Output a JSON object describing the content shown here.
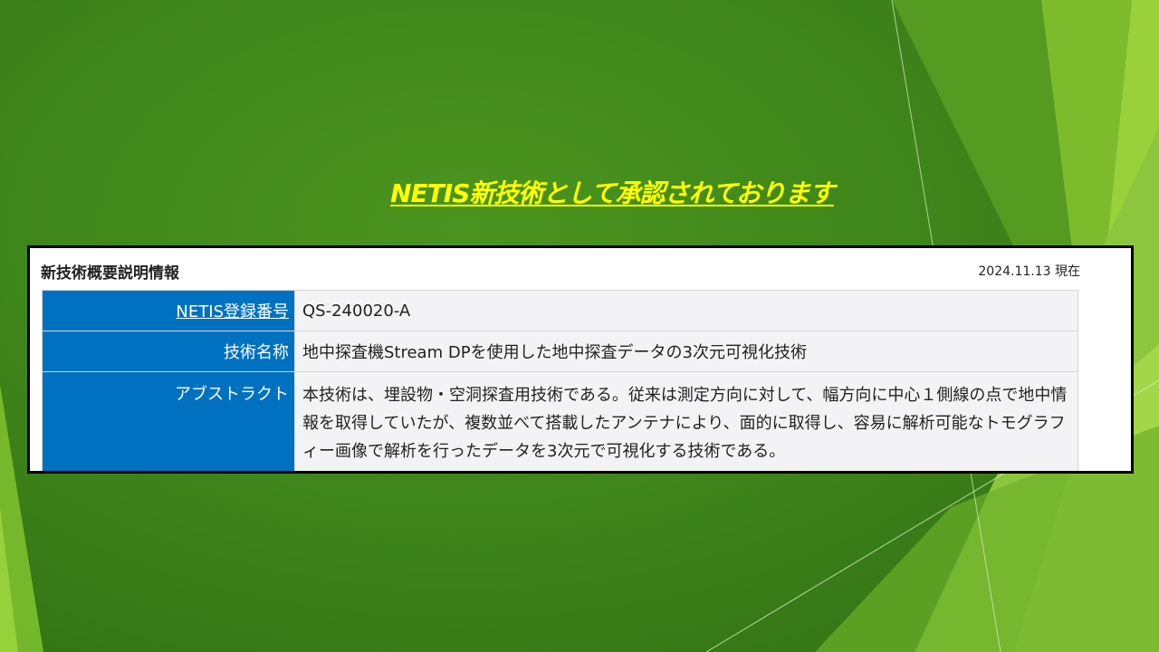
{
  "slide": {
    "title": "NETIS新技術として承認されております"
  },
  "panel": {
    "title": "新技術概要説明情報",
    "date": "2024.11.13 現在"
  },
  "rows": [
    {
      "label": "NETIS登録番号",
      "value": "QS-240020-A"
    },
    {
      "label": "技術名称",
      "value": "地中探査機Stream DPを使用した地中探査データの3次元可視化技術"
    },
    {
      "label": "アブストラクト",
      "value": "本技術は、埋設物・空洞探査用技術である。従来は測定方向に対して、幅方向に中心１側線の点で地中情報を取得していたが、複数並べて搭載したアンテナにより、面的に取得し、容易に解析可能なトモグラフィー画像で解析を行ったデータを3次元で可視化する技術である。"
    }
  ],
  "colors": {
    "background": "#3f861b",
    "accent_light_green": "#8cc63f",
    "title_yellow": "#ffff00",
    "label_blue": "#0071c0"
  }
}
